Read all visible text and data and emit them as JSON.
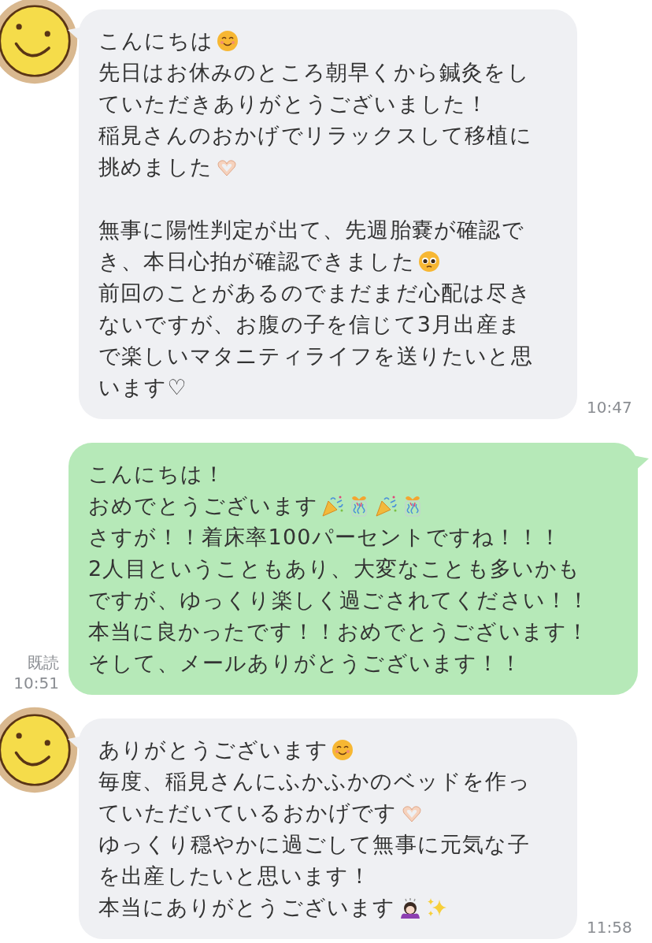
{
  "messages": [
    {
      "kind": "incoming",
      "time": "10:47",
      "paragraphs": [
        [
          {
            "text": "こんにちは",
            "icons": [
              {
                "kind": "smiling"
              }
            ]
          },
          {
            "text": "先日はお休みのところ朝早くから鍼灸をし"
          },
          {
            "text": "ていただきありがとうございました！"
          },
          {
            "text": "稲見さんのおかげでリラックスして移植に"
          },
          {
            "text": "挑めました",
            "icons": [
              {
                "kind": "hearthands"
              }
            ]
          }
        ],
        [
          {
            "text": "無事に陽性判定が出て、先週胎嚢が確認で"
          },
          {
            "text": "き、本日心拍が確認できました",
            "icons": [
              {
                "kind": "pleading"
              }
            ]
          },
          {
            "text": "前回のことがあるのでまだまだ心配は尽き"
          },
          {
            "text": "ないですが、お腹の子を信じて3月出産ま"
          },
          {
            "text": "で楽しいマタニティライフを送りたいと思"
          },
          {
            "text": "います♡"
          }
        ]
      ]
    },
    {
      "kind": "outgoing",
      "read": "既読",
      "time": "10:51",
      "paragraphs": [
        [
          {
            "text": "こんにちは！"
          },
          {
            "text": "おめでとうございます",
            "icons": [
              {
                "kind": "popper"
              },
              {
                "kind": "gift"
              },
              {
                "kind": "popper"
              },
              {
                "kind": "gift"
              }
            ]
          },
          {
            "text": "さすが！！着床率100パーセントですね！！！"
          },
          {
            "text": "2人目ということもあり、大変なことも多いかも"
          },
          {
            "text": "ですが、ゆっくり楽しく過ごされてください！！"
          },
          {
            "text": "本当に良かったです！！おめでとうございます！"
          },
          {
            "text": "そして、メールありがとうございます！！"
          }
        ]
      ]
    },
    {
      "kind": "incoming",
      "time": "11:58",
      "paragraphs": [
        [
          {
            "text": "ありがとうございます",
            "icons": [
              {
                "kind": "smiling"
              }
            ]
          },
          {
            "text": "毎度、稲見さんにふかふかのベッドを作っ"
          },
          {
            "text": "ていただいているおかげです",
            "icons": [
              {
                "kind": "hearthands"
              }
            ]
          },
          {
            "text": "ゆっくり穏やかに過ごして無事に元気な子"
          },
          {
            "text": "を出産したいと思います！"
          },
          {
            "text": "本当にありがとうございます",
            "icons": [
              {
                "kind": "bowing"
              },
              {
                "kind": "sparkles"
              }
            ]
          }
        ]
      ]
    }
  ]
}
